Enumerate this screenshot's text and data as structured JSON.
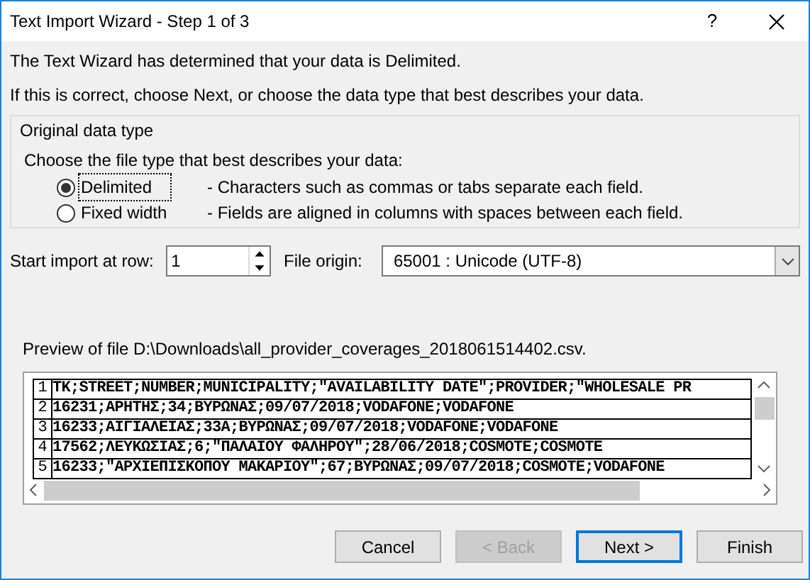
{
  "window": {
    "title": "Text Import Wizard - Step 1 of 3",
    "help": "?"
  },
  "intro": [
    "The Text Wizard has determined that your data is Delimited.",
    "If this is correct, choose Next, or choose the data type that best describes your data."
  ],
  "data_type": {
    "legend": "Original data type",
    "prompt": "Choose the file type that best describes your data:",
    "options": [
      {
        "label": "Delimited",
        "description": "- Characters such as commas or tabs separate each field.",
        "selected": true,
        "focused": true
      },
      {
        "label": "Fixed width",
        "description": "- Fields are aligned in columns with spaces between each field.",
        "selected": false,
        "focused": false
      }
    ]
  },
  "start_row": {
    "label": "Start import at row:",
    "value": "1"
  },
  "file_origin": {
    "label": "File origin:",
    "value": "65001 : Unicode (UTF-8)"
  },
  "preview": {
    "label": "Preview of file D:\\Downloads\\all_provider_coverages_2018061514402.csv.",
    "rows": [
      {
        "number": "1",
        "text": "TK;STREET;NUMBER;MUNICIPALITY;\"AVAILABILITY DATE\";PROVIDER;\"WHOLESALE PR"
      },
      {
        "number": "2",
        "text": "16231;ΑΡΗΤΗΣ;34;ΒΥΡΩΝΑΣ;09/07/2018;VODAFONE;VODAFONE"
      },
      {
        "number": "3",
        "text": "16233;ΑΙΓΙΑΛΕΙΑΣ;33Α;ΒΥΡΩΝΑΣ;09/07/2018;VODAFONE;VODAFONE"
      },
      {
        "number": "4",
        "text": "17562;ΛΕΥΚΩΣΙΑΣ;6;\"ΠΑΛΑΙΟΥ ΦΑΛΗΡΟΥ\";28/06/2018;COSMOTE;COSMOTE"
      },
      {
        "number": "5",
        "text": "16233;\"ΑΡΧΙΕΠΙΣΚΟΠΟΥ ΜΑΚΑΡΙΟΥ\";67;ΒΥΡΩΝΑΣ;09/07/2018;COSMOTE;VODAFONE"
      }
    ]
  },
  "buttons": [
    {
      "label": "Cancel",
      "disabled": false,
      "default": false
    },
    {
      "label": "< Back",
      "disabled": true,
      "default": false
    },
    {
      "label": "Next >",
      "disabled": false,
      "default": true
    },
    {
      "label": "Finish",
      "disabled": false,
      "default": false
    }
  ]
}
